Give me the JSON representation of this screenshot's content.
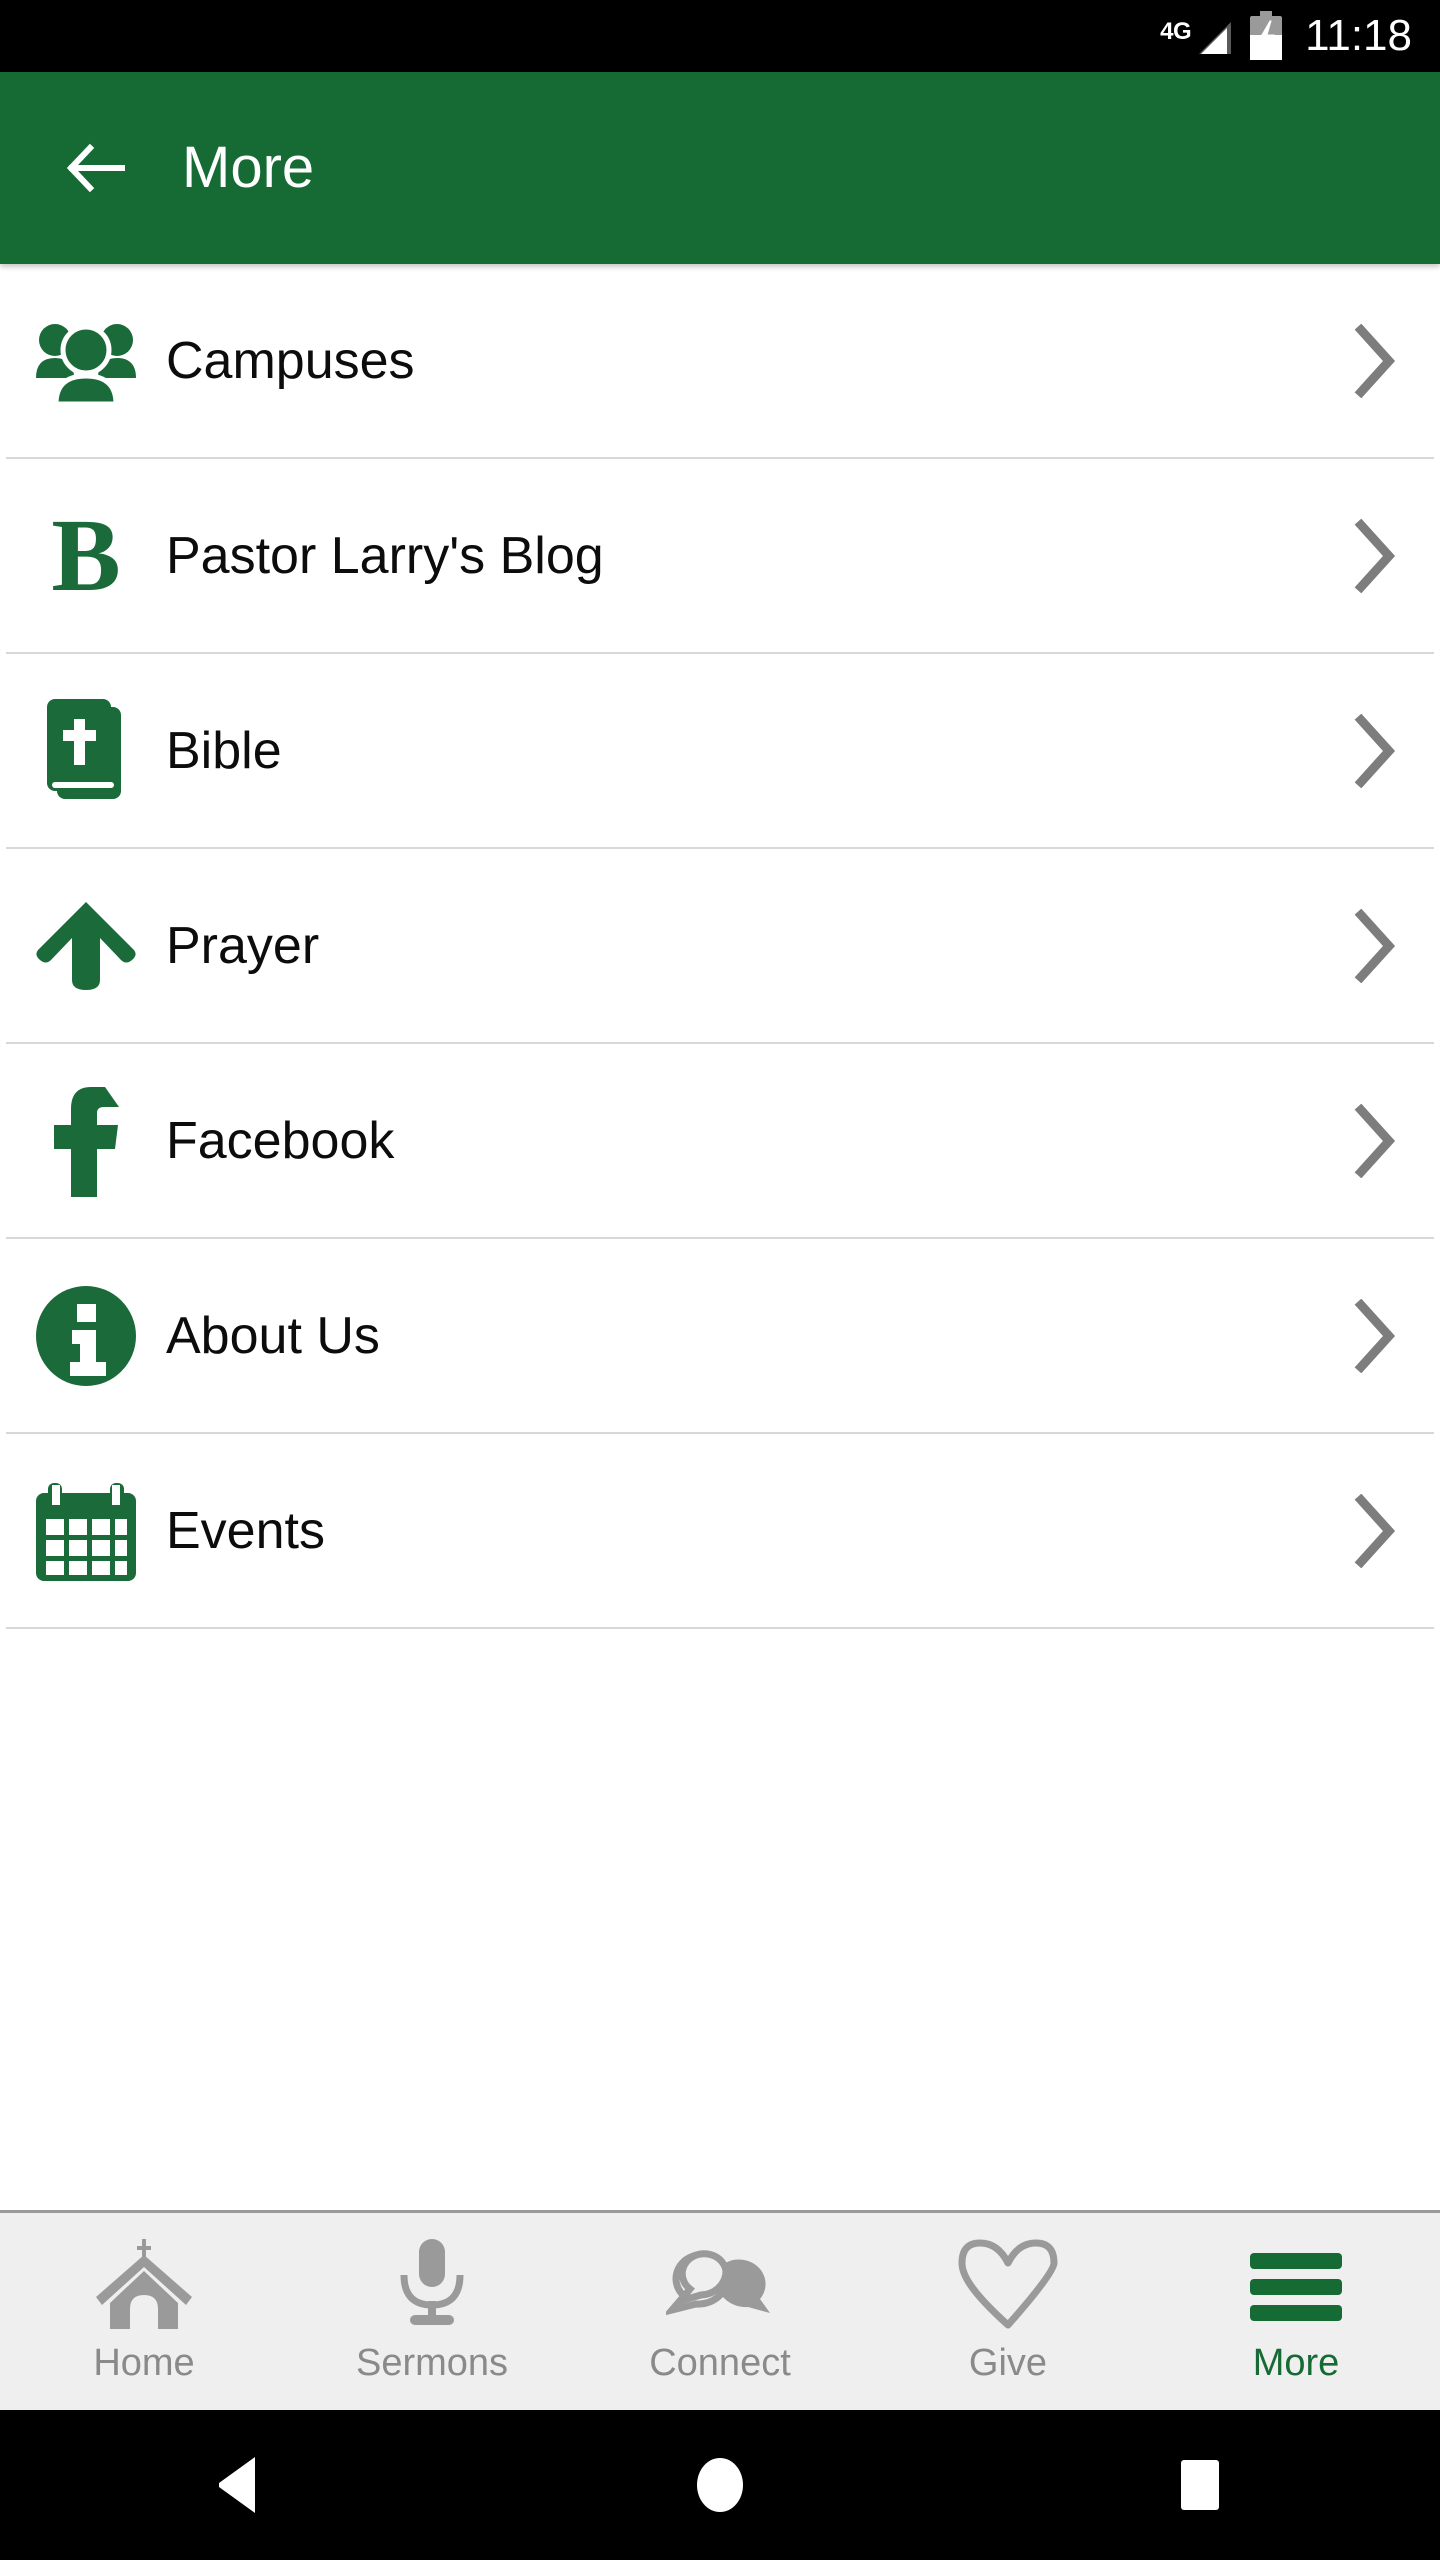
{
  "status_bar": {
    "network_label": "4G",
    "time": "11:18",
    "signal_icon": "signal-triangle-icon",
    "battery_icon": "battery-charging-icon"
  },
  "app_bar": {
    "title": "More",
    "back_icon": "back-arrow-icon",
    "background_color": "#166B35"
  },
  "menu": {
    "items": [
      {
        "label": "Campuses",
        "icon": "people-group-icon",
        "chevron": "chevron-right-icon"
      },
      {
        "label": "Pastor Larry's Blog",
        "icon": "blog-b-icon",
        "chevron": "chevron-right-icon"
      },
      {
        "label": "Bible",
        "icon": "bible-book-icon",
        "chevron": "chevron-right-icon"
      },
      {
        "label": "Prayer",
        "icon": "arrow-up-icon",
        "chevron": "chevron-right-icon"
      },
      {
        "label": "Facebook",
        "icon": "facebook-f-icon",
        "chevron": "chevron-right-icon"
      },
      {
        "label": "About Us",
        "icon": "info-circle-icon",
        "chevron": "chevron-right-icon"
      },
      {
        "label": "Events",
        "icon": "calendar-icon",
        "chevron": "chevron-right-icon"
      }
    ],
    "icon_color": "#1B6B3A",
    "text_color": "#0C0C0C",
    "divider_color": "#D8D8D8"
  },
  "tab_bar": {
    "background_color": "#EFEFEF",
    "inactive_color": "#8A8A8A",
    "active_color": "#166B35",
    "tabs": [
      {
        "label": "Home",
        "icon": "church-icon",
        "active": false
      },
      {
        "label": "Sermons",
        "icon": "microphone-icon",
        "active": false
      },
      {
        "label": "Connect",
        "icon": "chat-bubbles-icon",
        "active": false
      },
      {
        "label": "Give",
        "icon": "heart-outline-icon",
        "active": false
      },
      {
        "label": "More",
        "icon": "hamburger-menu-icon",
        "active": true
      }
    ]
  },
  "android_nav": {
    "back_icon": "nav-back-triangle-icon",
    "home_icon": "nav-home-circle-icon",
    "recents_icon": "nav-recents-square-icon"
  }
}
